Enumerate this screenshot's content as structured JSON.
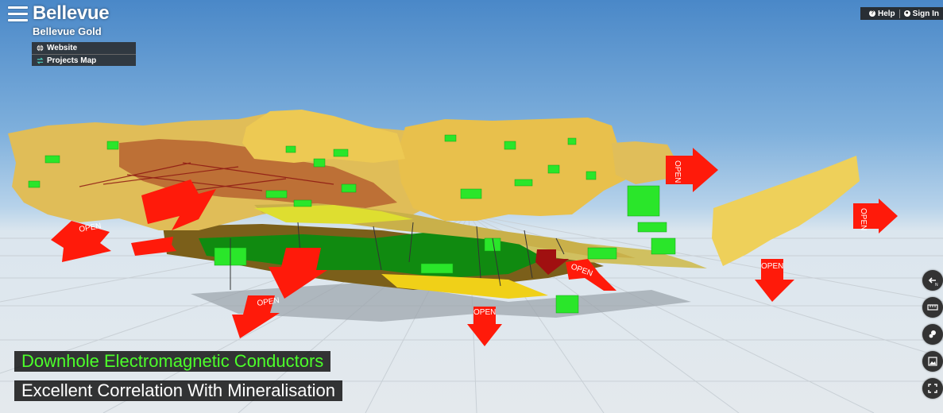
{
  "header": {
    "title": "Bellevue",
    "subtitle": "Bellevue Gold"
  },
  "links": [
    {
      "label": "Website",
      "icon": "globe-icon"
    },
    {
      "label": "Projects Map",
      "icon": "swap-icon"
    }
  ],
  "topbar": {
    "help_label": "Help",
    "signin_label": "Sign In"
  },
  "scene": {
    "arrow_label": "OPEN",
    "colors": {
      "gold": "#e8c44c",
      "dark_gold": "#8a6a1c",
      "green": "#2ae62a",
      "dark_green": "#138a13",
      "red_arrow": "#ff1a0a",
      "sky_top": "#4a88c8"
    }
  },
  "captions": {
    "line1": "Downhole Electromagnetic Conductors",
    "line2": "Excellent Correlation With Mineralisation"
  },
  "controls": [
    {
      "name": "compass-north-button",
      "icon": "compass-icon"
    },
    {
      "name": "measure-button",
      "icon": "ruler-icon"
    },
    {
      "name": "layers-button",
      "icon": "layers-icon"
    },
    {
      "name": "image-button",
      "icon": "image-icon"
    },
    {
      "name": "fullscreen-button",
      "icon": "fullscreen-icon"
    }
  ]
}
